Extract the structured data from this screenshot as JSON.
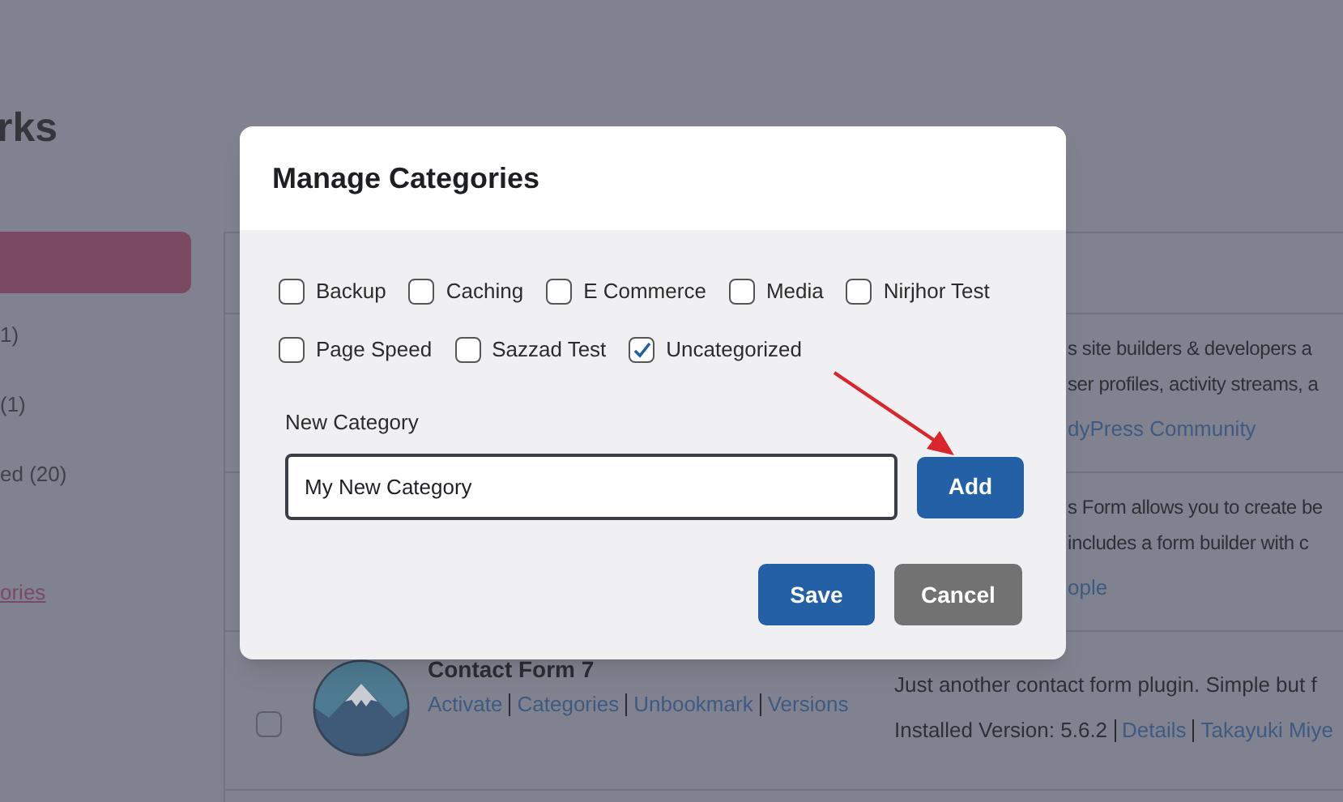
{
  "page": {
    "title": "rks",
    "sidebar": {
      "items": [
        {
          "label": "1)"
        },
        {
          "label": "(1)"
        },
        {
          "label": "ed (20)"
        }
      ],
      "link": "ories"
    },
    "table": {
      "rows": [
        {
          "kind": "partial",
          "description": [
            "s site builders & developers a",
            "ser profiles, activity streams, a"
          ],
          "author": "dyPress Community"
        },
        {
          "kind": "partial",
          "description": [
            "s Form allows you to create be",
            "includes a form builder with c"
          ],
          "author": "ople"
        },
        {
          "kind": "plugin",
          "checked": false,
          "name": "Contact Form 7",
          "actions": [
            "Activate",
            "Categories",
            "Unbookmark",
            "Versions"
          ],
          "description": [
            "Just another contact form plugin. Simple but f"
          ],
          "version": "Installed Version: 5.6.2",
          "details": "Details",
          "author": "Takayuki Miye"
        }
      ]
    }
  },
  "dialog": {
    "title": "Manage Categories",
    "categories": [
      {
        "label": "Backup",
        "checked": false
      },
      {
        "label": "Caching",
        "checked": false
      },
      {
        "label": "E Commerce",
        "checked": false
      },
      {
        "label": "Media",
        "checked": false
      },
      {
        "label": "Nirjhor Test",
        "checked": false
      },
      {
        "label": "Page Speed",
        "checked": false
      },
      {
        "label": "Sazzad Test",
        "checked": false
      },
      {
        "label": "Uncategorized",
        "checked": true
      }
    ],
    "new_category": {
      "label": "New Category",
      "value": "My New Category"
    },
    "add_button": "Add",
    "buttons": [
      {
        "label": "Save",
        "kind": "primary"
      },
      {
        "label": "Cancel",
        "kind": "secondary"
      }
    ]
  }
}
